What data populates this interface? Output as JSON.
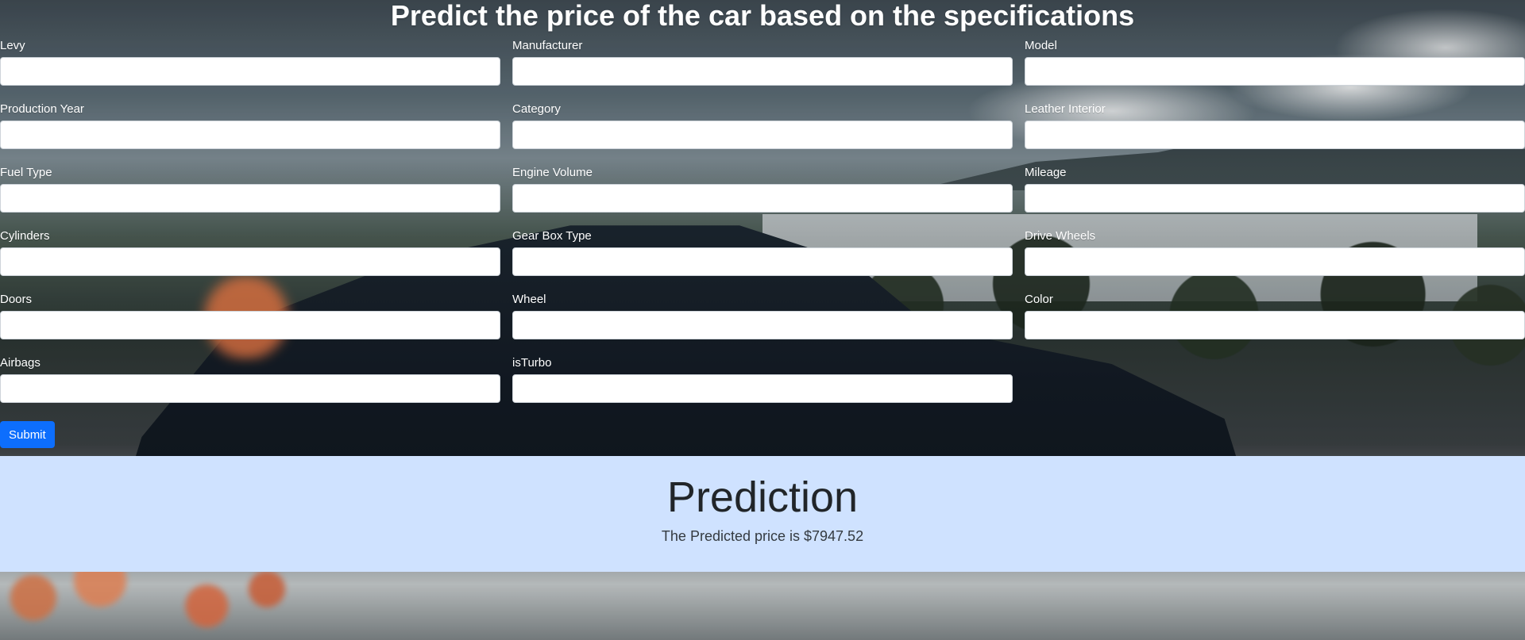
{
  "page_title": "Predict the price of the car based on the specifications",
  "form": {
    "fields": [
      {
        "label": "Levy",
        "value": ""
      },
      {
        "label": "Manufacturer",
        "value": ""
      },
      {
        "label": "Model",
        "value": ""
      },
      {
        "label": "Production Year",
        "value": ""
      },
      {
        "label": "Category",
        "value": ""
      },
      {
        "label": "Leather Interior",
        "value": ""
      },
      {
        "label": "Fuel Type",
        "value": ""
      },
      {
        "label": "Engine Volume",
        "value": ""
      },
      {
        "label": "Mileage",
        "value": ""
      },
      {
        "label": "Cylinders",
        "value": ""
      },
      {
        "label": "Gear Box Type",
        "value": ""
      },
      {
        "label": "Drive Wheels",
        "value": ""
      },
      {
        "label": "Doors",
        "value": ""
      },
      {
        "label": "Wheel",
        "value": ""
      },
      {
        "label": "Color",
        "value": ""
      },
      {
        "label": "Airbags",
        "value": ""
      },
      {
        "label": "isTurbo",
        "value": ""
      }
    ],
    "submit_label": "Submit",
    "submit_color": "#0d6efd"
  },
  "prediction": {
    "title": "Prediction",
    "text": "The Predicted price is $7947.52",
    "background_color": "#cfe2ff"
  }
}
